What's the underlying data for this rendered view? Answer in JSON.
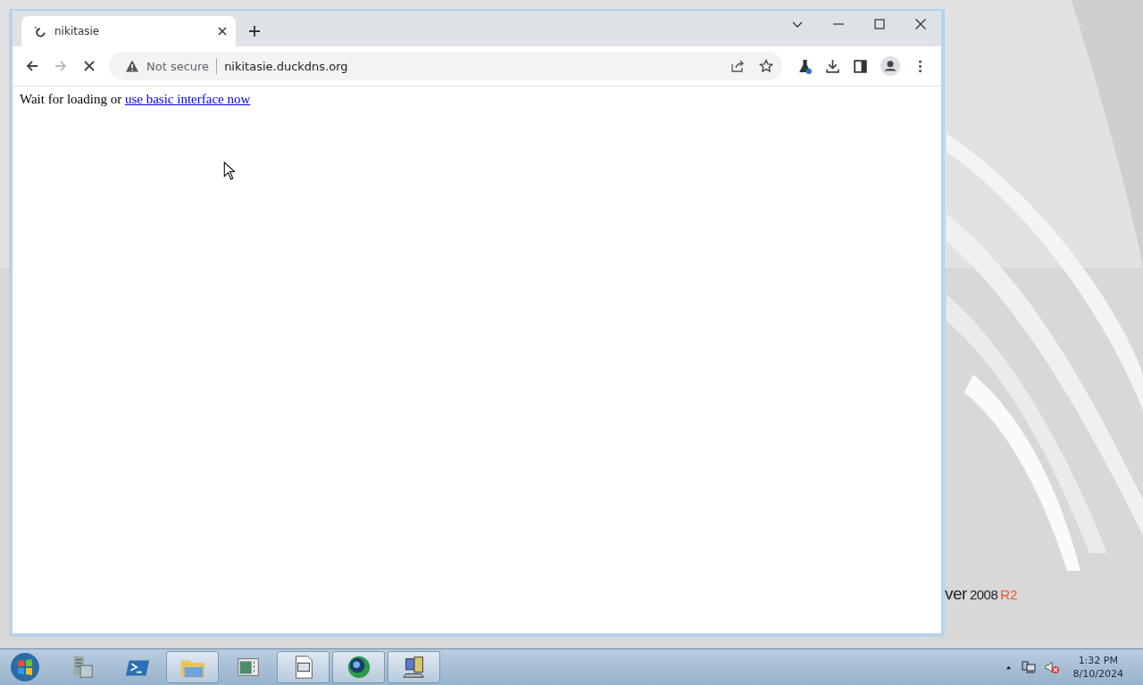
{
  "desktop": {
    "branding": [
      {
        "text": "ver",
        "kind": "main"
      },
      {
        "text": "2008",
        "kind": "main"
      },
      {
        "text": "R2",
        "kind": "accent"
      }
    ]
  },
  "browser": {
    "tabs": [
      {
        "title": "nikitasie",
        "selected": true
      }
    ],
    "toolbar": {
      "loading": true,
      "security": "Not secure",
      "url": "nikitasie.duckdns.org"
    },
    "page": {
      "text": "Wait for loading or",
      "link": "use basic interface now"
    }
  },
  "taskbar": {
    "items": [
      {
        "kind": "server",
        "active": false
      },
      {
        "kind": "shell",
        "active": false
      },
      {
        "kind": "folder",
        "active": true
      },
      {
        "kind": "panel",
        "active": false
      },
      {
        "kind": "document",
        "active": true
      },
      {
        "kind": "globe",
        "active": true
      },
      {
        "kind": "computer",
        "active": true
      }
    ],
    "clock": {
      "time": "1:32 PM",
      "date": "8/10/2024"
    }
  }
}
